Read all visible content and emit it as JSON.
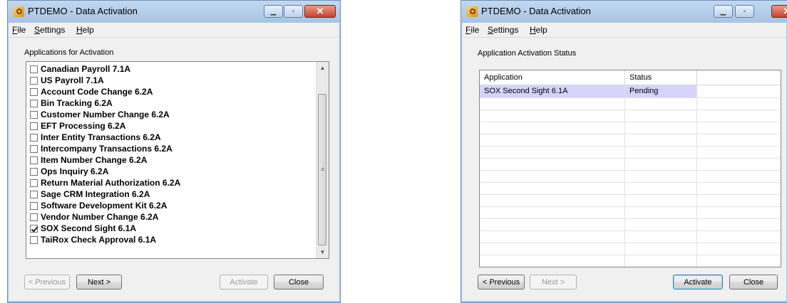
{
  "window_left": {
    "title": "PTDEMO - Data Activation",
    "menu": [
      "File",
      "Settings",
      "Help"
    ],
    "group_label": "Applications for Activation",
    "items": [
      {
        "label": "Canadian Payroll 7.1A",
        "checked": false
      },
      {
        "label": "US Payroll 7.1A",
        "checked": false
      },
      {
        "label": "Account Code Change 6.2A",
        "checked": false
      },
      {
        "label": "Bin Tracking 6.2A",
        "checked": false
      },
      {
        "label": "Customer Number Change 6.2A",
        "checked": false
      },
      {
        "label": "EFT Processing 6.2A",
        "checked": false
      },
      {
        "label": "Inter Entity Transactions 6.2A",
        "checked": false
      },
      {
        "label": "Intercompany Transactions 6.2A",
        "checked": false
      },
      {
        "label": "Item Number Change 6.2A",
        "checked": false
      },
      {
        "label": "Ops Inquiry 6.2A",
        "checked": false
      },
      {
        "label": "Return Material Authorization 6.2A",
        "checked": false
      },
      {
        "label": "Sage CRM Integration 6.2A",
        "checked": false
      },
      {
        "label": "Software Development Kit 6.2A",
        "checked": false
      },
      {
        "label": "Vendor Number Change 6.2A",
        "checked": false
      },
      {
        "label": "SOX Second Sight 6.1A",
        "checked": true
      },
      {
        "label": "TaiRox Check Approval 6.1A",
        "checked": false
      }
    ],
    "buttons": {
      "previous": "< Previous",
      "next": "Next >",
      "activate": "Activate",
      "close": "Close"
    }
  },
  "window_right": {
    "title": "PTDEMO - Data Activation",
    "menu": [
      "File",
      "Settings",
      "Help"
    ],
    "group_label": "Application Activation Status",
    "columns": [
      "Application",
      "Status",
      ""
    ],
    "rows": [
      {
        "application": "SOX Second Sight 6.1A",
        "status": "Pending"
      }
    ],
    "buttons": {
      "previous": "< Previous",
      "next": "Next >",
      "activate": "Activate",
      "close": "Close"
    }
  },
  "colors": {
    "titlebar": "#aac6e6",
    "client": "#f0f0f0",
    "selected_row": "#d6d3fb"
  }
}
